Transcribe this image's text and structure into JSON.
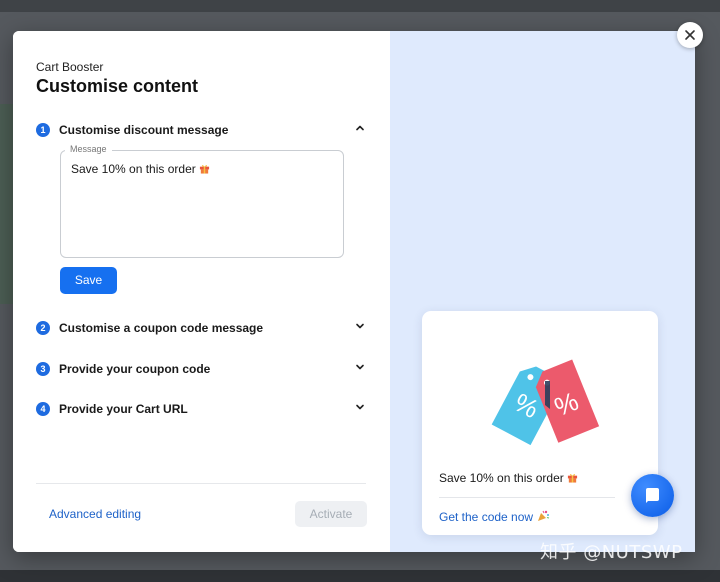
{
  "modal": {
    "app_name": "Cart Booster",
    "title": "Customise content",
    "steps": [
      {
        "number": "1",
        "label": "Customise discount message",
        "expanded": true
      },
      {
        "number": "2",
        "label": "Customise a coupon code message",
        "expanded": false
      },
      {
        "number": "3",
        "label": "Provide your coupon code",
        "expanded": false
      },
      {
        "number": "4",
        "label": "Provide your Cart URL",
        "expanded": false
      }
    ],
    "message_field": {
      "legend": "Message",
      "value": "Save 10% on this order",
      "emoji_icon": "gift-icon"
    },
    "save_label": "Save",
    "advanced_editing_label": "Advanced editing",
    "activate_label": "Activate"
  },
  "preview": {
    "message": "Save 10% on this order",
    "message_icon": "gift-icon",
    "link_label": "Get the code now",
    "link_icon": "party-popper-icon",
    "tag_icon": "discount-tags-icon"
  },
  "colors": {
    "accent": "#1670f0",
    "step_badge": "#1e6be0",
    "link": "#1e62c8",
    "preview_bg": "#dfeafd",
    "tag_blue": "#4fc3e8",
    "tag_red": "#ec5a6c"
  },
  "watermark": "知乎 @NUTSWP"
}
